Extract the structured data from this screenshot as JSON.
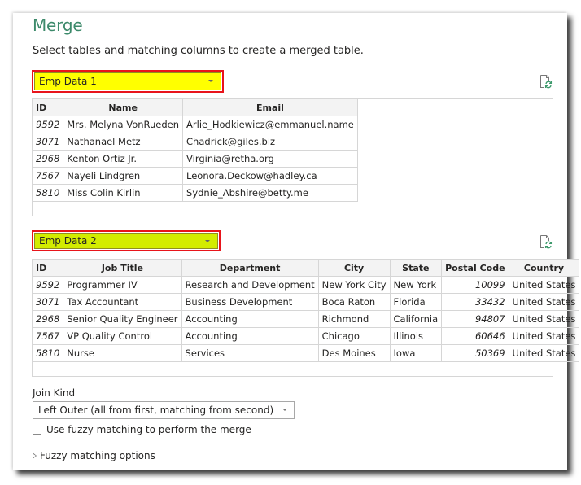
{
  "dialog": {
    "title": "Merge",
    "subtitle": "Select tables and matching columns to create a merged table."
  },
  "colors": {
    "title": "#3d8a6b",
    "highlight_border": "#e8141b",
    "table1_select_fill": "#ffff00",
    "table2_select_fill": "#d3ec00"
  },
  "table1": {
    "selected": "Emp Data 1",
    "refresh_icon": "file-refresh-icon",
    "columns": [
      "ID",
      "Name",
      "Email"
    ],
    "rows": [
      [
        "9592",
        "Mrs. Melyna VonRueden",
        "Arlie_Hodkiewicz@emmanuel.name"
      ],
      [
        "3071",
        "Nathanael Metz",
        "Chadrick@giles.biz"
      ],
      [
        "2968",
        "Kenton Ortiz Jr.",
        "Virginia@retha.org"
      ],
      [
        "7567",
        "Nayeli Lindgren",
        "Leonora.Deckow@hadley.ca"
      ],
      [
        "5810",
        "Miss Colin Kirlin",
        "Sydnie_Abshire@betty.me"
      ]
    ]
  },
  "table2": {
    "selected": "Emp Data 2",
    "refresh_icon": "file-refresh-icon",
    "columns": [
      "ID",
      "Job Title",
      "Department",
      "City",
      "State",
      "Postal Code",
      "Country"
    ],
    "rows": [
      [
        "9592",
        "Programmer IV",
        "Research and Development",
        "New York City",
        "New York",
        "10099",
        "United States"
      ],
      [
        "3071",
        "Tax Accountant",
        "Business Development",
        "Boca Raton",
        "Florida",
        "33432",
        "United States"
      ],
      [
        "2968",
        "Senior Quality Engineer",
        "Accounting",
        "Richmond",
        "California",
        "94807",
        "United States"
      ],
      [
        "7567",
        "VP Quality Control",
        "Accounting",
        "Chicago",
        "Illinois",
        "60646",
        "United States"
      ],
      [
        "5810",
        "Nurse",
        "Services",
        "Des Moines",
        "Iowa",
        "50369",
        "United States"
      ]
    ]
  },
  "join": {
    "label": "Join Kind",
    "selected": "Left Outer (all from first, matching from second)",
    "fuzzy_checkbox_label": "Use fuzzy matching to perform the merge",
    "fuzzy_checked": false,
    "fuzzy_options_label": "Fuzzy matching options"
  }
}
